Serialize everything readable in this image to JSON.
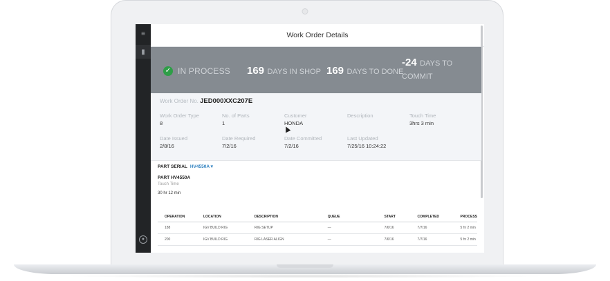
{
  "header": {
    "title": "Work Order Details"
  },
  "sidebar": {
    "icons": [
      "menu-icon",
      "document-icon",
      "user-icon"
    ]
  },
  "status": {
    "label": "IN PROCESS",
    "shop_days": "169",
    "shop_label": "DAYS IN SHOP",
    "done_days": "169",
    "done_label": "DAYS TO DONE",
    "commit_days": "-24",
    "commit_label": "DAYS TO COMMIT",
    "colors": {
      "banner": "#858b91",
      "check": "#2e9e47"
    }
  },
  "work_order": {
    "number_label": "Work Order No.",
    "number": "JED000XXC207E",
    "fields": [
      {
        "key": "Work Order Type",
        "value": "8"
      },
      {
        "key": "No. of Parts",
        "value": "1"
      },
      {
        "key": "Customer",
        "value": "HONDA"
      },
      {
        "key": "Description",
        "value": ""
      },
      {
        "key": "Touch Time",
        "value": "3hrs 3 min"
      },
      {
        "key": "Date Issued",
        "value": "2/8/16"
      },
      {
        "key": "Date Required",
        "value": "7/2/16"
      },
      {
        "key": "Date Committed",
        "value": "7/2/16"
      },
      {
        "key": "Last Updated",
        "value": "7/25/16 10:24:22"
      }
    ]
  },
  "part": {
    "serial_label": "PART SERIAL",
    "serial_value": "HV4550A ▾",
    "name": "PART HV4550A",
    "touch_time_label": "Touch Time",
    "touch_time_value": "30 hr 12 min",
    "columns": [
      "OPERATION",
      "LOCATION",
      "DESCRIPTION",
      "QUEUE",
      "START",
      "COMPLETED",
      "PROCESS"
    ],
    "rows": [
      [
        "188",
        "IGV BUILD RIG",
        "RIG SETUP",
        "—",
        "7/6/16",
        "7/7/16",
        "5 hr 2 min"
      ],
      [
        "200",
        "IGV BUILD RIG",
        "RIG LASER ALIGN",
        "—",
        "7/6/16",
        "7/7/16",
        "5 hr 2 min"
      ]
    ]
  }
}
